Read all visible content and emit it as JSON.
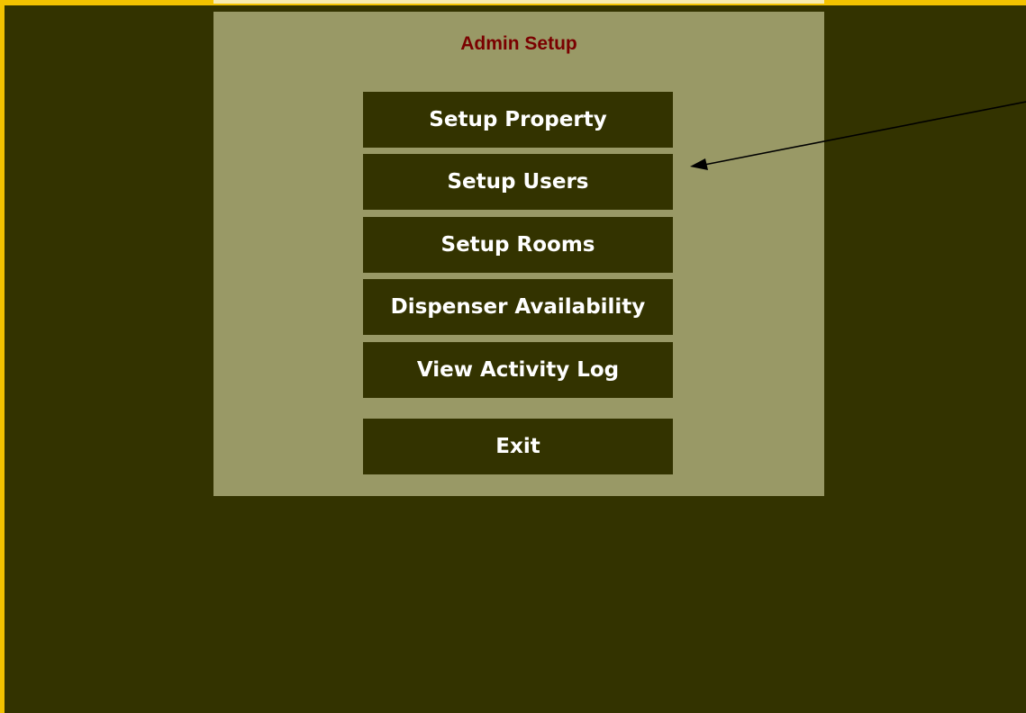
{
  "panel": {
    "title": "Admin Setup"
  },
  "menu": {
    "items": [
      {
        "key": "setup-property",
        "label": "Setup Property"
      },
      {
        "key": "setup-users",
        "label": "Setup Users"
      },
      {
        "key": "setup-rooms",
        "label": "Setup Rooms"
      },
      {
        "key": "dispenser-availability",
        "label": "Dispenser Availability"
      },
      {
        "key": "view-activity-log",
        "label": "View Activity Log"
      }
    ],
    "exit_label": "Exit"
  },
  "colors": {
    "background": "#333300",
    "panel": "#999966",
    "frame": "#f2c200",
    "title": "#7a0000",
    "button": "#333300",
    "button_text": "#ffffff"
  },
  "annotation": {
    "arrow_icon": "arrow-icon",
    "points_to": "setup-users"
  }
}
